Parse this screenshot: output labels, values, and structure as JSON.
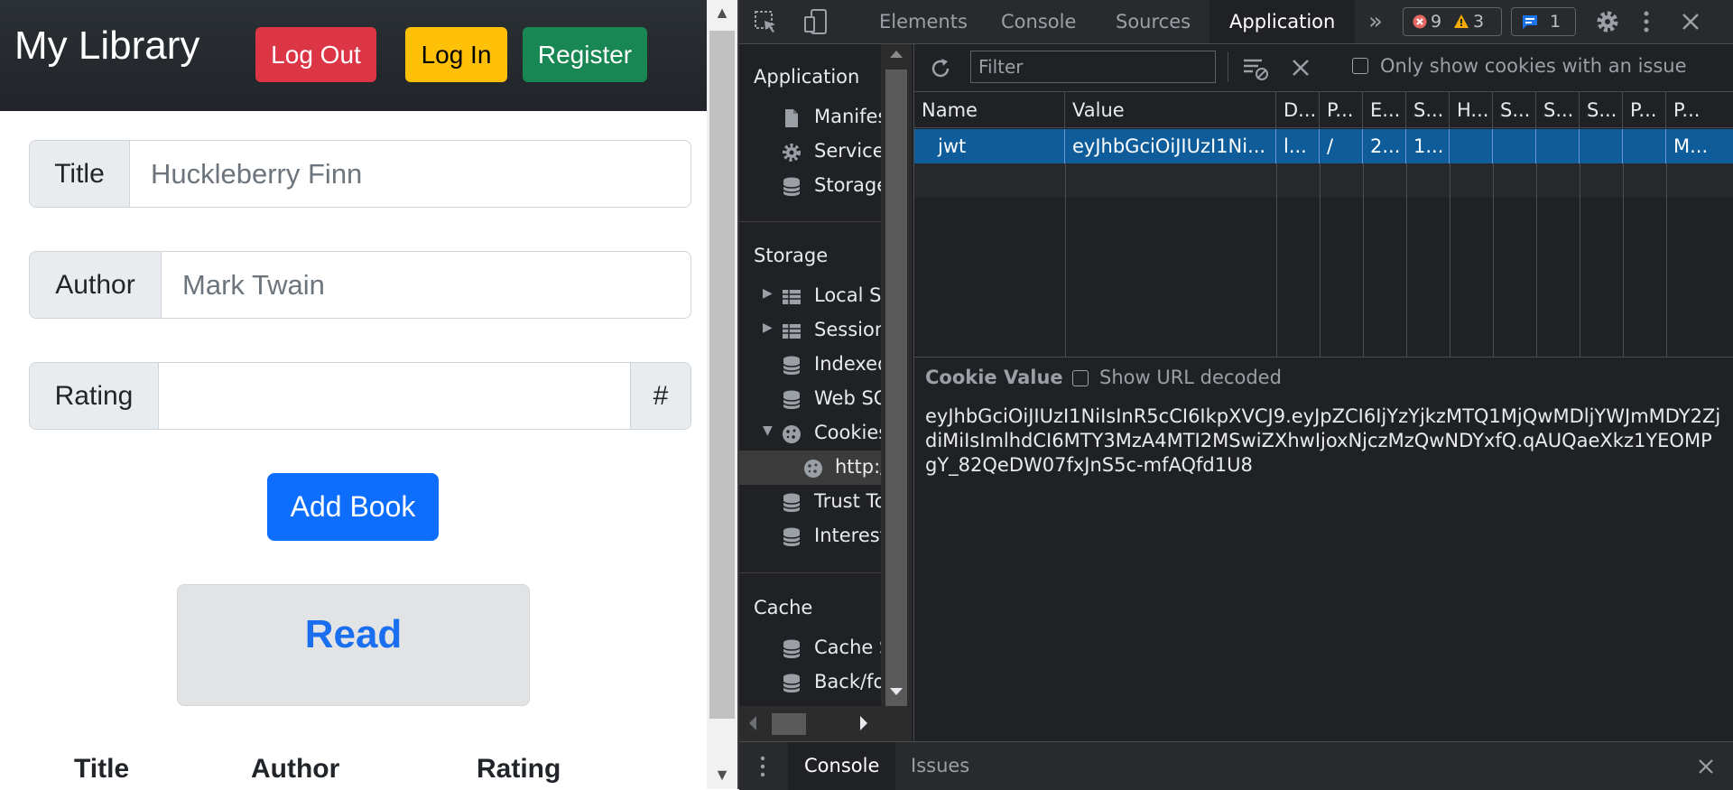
{
  "app": {
    "brand": "My Library",
    "nav": {
      "logout": "Log Out",
      "login": "Log In",
      "register": "Register"
    },
    "form": {
      "title_label": "Title",
      "title_placeholder": "Huckleberry Finn",
      "author_label": "Author",
      "author_placeholder": "Mark Twain",
      "rating_label": "Rating",
      "rating_value": "",
      "rating_suffix": "#",
      "add_button": "Add Book"
    },
    "read_section": {
      "title": "Read"
    },
    "table_headers": [
      "Title",
      "Author",
      "Rating"
    ]
  },
  "devtools": {
    "tabs": [
      "Elements",
      "Console",
      "Sources",
      "Application"
    ],
    "active_tab": "Application",
    "more_tabs": "»",
    "badges": {
      "errors": "9",
      "warnings": "3",
      "messages": "1"
    },
    "sidebar": {
      "sections": [
        "Application",
        "Storage",
        "Cache"
      ],
      "application_items": [
        {
          "label": "Manifest",
          "icon": "file-icon"
        },
        {
          "label": "Service Workers",
          "icon": "gear-icon"
        },
        {
          "label": "Storage",
          "icon": "database-icon"
        }
      ],
      "storage_items": [
        {
          "label": "Local Storage",
          "icon": "grid-icon",
          "expander": "▶"
        },
        {
          "label": "Session Storage",
          "icon": "grid-icon",
          "expander": "▶"
        },
        {
          "label": "IndexedDB",
          "icon": "database-icon"
        },
        {
          "label": "Web SQL",
          "icon": "database-icon"
        },
        {
          "label": "Cookies",
          "icon": "cookie-icon",
          "expander": "▼"
        },
        {
          "label": "http://",
          "icon": "cookie-icon"
        },
        {
          "label": "Trust Tokens",
          "icon": "database-icon"
        },
        {
          "label": "Interest Groups",
          "icon": "database-icon"
        }
      ],
      "cache_items": [
        {
          "label": "Cache Storage",
          "icon": "database-icon"
        },
        {
          "label": "Back/forward cache",
          "icon": "database-icon"
        }
      ]
    },
    "cookies": {
      "filter_placeholder": "Filter",
      "issue_filter_label": "Only show cookies with an issue",
      "columns": [
        "Name",
        "Value",
        "D...",
        "P...",
        "E...",
        "S...",
        "H...",
        "S...",
        "S...",
        "S...",
        "P...",
        "P..."
      ],
      "rows": [
        [
          "jwt",
          "eyJhbGciOiJIUzI1Ni...",
          "l...",
          "/",
          "2...",
          "1...",
          "",
          "",
          "",
          "",
          "",
          "M..."
        ]
      ],
      "value_pane_title": "Cookie Value",
      "url_decode_label": "Show URL decoded",
      "value": "eyJhbGciOiJIUzI1NiIsInR5cCI6IkpXVCJ9.eyJpZCI6IjYzYjkzMTQ1MjQwMDljYWJmMDY2ZjdiMiIsImlhdCI6MTY3MzA4MTI2MSwiZXhwIjoxNjczMzQwNDYxfQ.qAUQaeXkz1YEOMPgY_82QeDW07fxJnS5c-mfAQfd1U8"
    },
    "drawer": {
      "console": "Console",
      "issues": "Issues"
    }
  }
}
